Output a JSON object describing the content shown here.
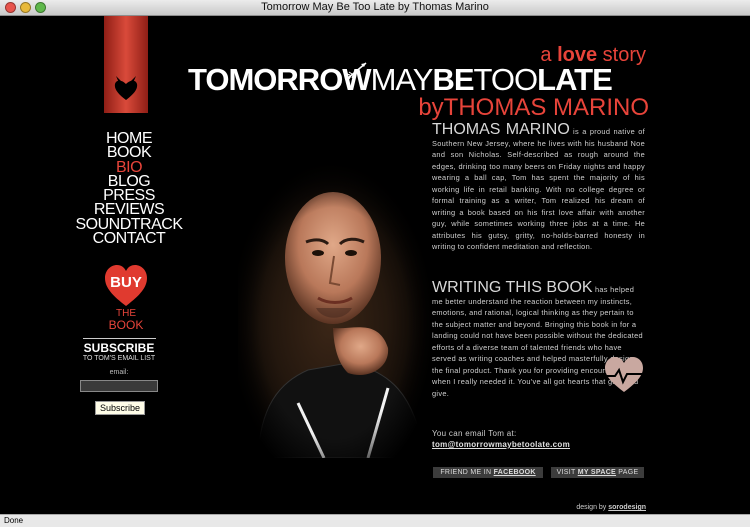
{
  "window": {
    "title": "Tomorrow May Be Too Late by Thomas Marino"
  },
  "header": {
    "tagline_prefix": "a",
    "tagline_bold": "love",
    "tagline_suffix": "story",
    "title_part1": "TOMORROW",
    "title_part2": "MAY",
    "title_part3": "BE",
    "title_part4": "TOO",
    "title_part5": "LATE",
    "byline": "byTHOMAS MARINO"
  },
  "nav": {
    "items": [
      "HOME",
      "BOOK",
      "BIO",
      "BLOG",
      "PRESS",
      "REVIEWS",
      "SOUNDTRACK",
      "CONTACT"
    ],
    "active": "BIO"
  },
  "buy": {
    "label": "BUY",
    "the": "THE",
    "book": "BOOK"
  },
  "subscribe": {
    "title": "SUBSCRIBE",
    "subtitle": "TO TOM'S EMAIL LIST",
    "email_label": "email:",
    "button": "Subscribe"
  },
  "bio": {
    "lead": "THOMAS MARINO",
    "text": " is a proud native of Southern New Jersey, where he lives with his husband Noe and son Nicholas. Self-described as rough around the edges, drinking too many beers on Friday nights and happy wearing a ball cap, Tom has spent the majority of his working life in retail banking. With no college degree or formal training as a writer, Tom realized his dream of writing a book based on his first love affair with another guy, while sometimes working three jobs at a time. He attributes his gutsy, gritty, no-holds-barred honesty in writing to confident meditation and reflection."
  },
  "writing": {
    "lead": "WRITING THIS BOOK",
    "text": " has helped me better understand the reaction between my instincts, emotions, and rational, logical thinking as they pertain to the subject matter and beyond. Bringing this book in for a landing could not have been possible without the dedicated efforts of a diverse team of talented friends who have served as writing coaches and helped masterfully design the final product. Thank you for providing encouragement when I really needed it. You've all got hearts that give and give."
  },
  "contact": {
    "prompt": "You can email Tom at:",
    "email": "tom@tomorrowmaybetoolate.com"
  },
  "social": {
    "fb_prefix": "FRIEND ME IN",
    "fb_bold": "FACEBOOK",
    "ms_prefix": "VISIT",
    "ms_bold": "MY SPACE",
    "ms_suffix": "PAGE"
  },
  "credit": {
    "prefix": "design by",
    "name": "sorodesign"
  },
  "status": {
    "text": "Done"
  },
  "colors": {
    "accent": "#e8443a",
    "background": "#000000"
  },
  "icons": [
    "heart-devil-icon",
    "buy-heart-icon",
    "arrow-through-heart-icon",
    "cupid-arrow-icon"
  ]
}
